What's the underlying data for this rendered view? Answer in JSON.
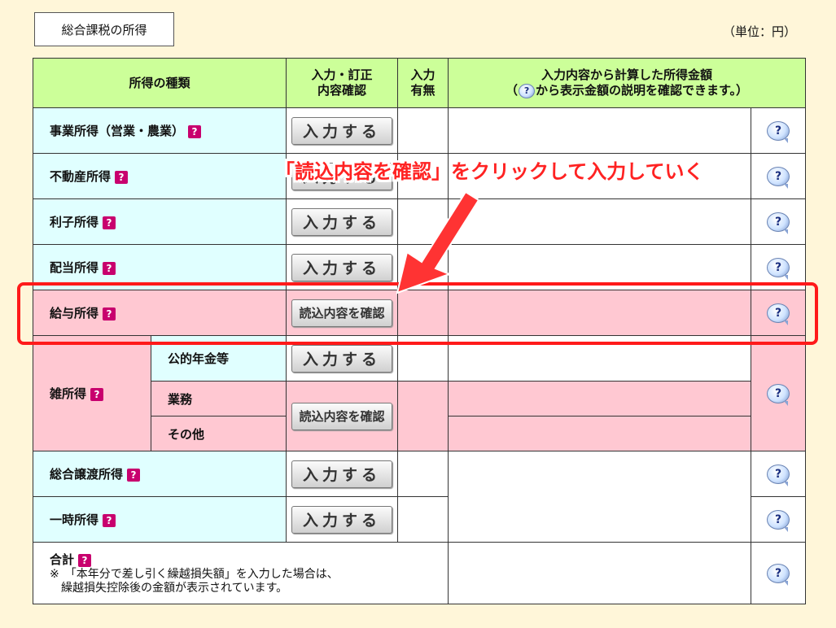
{
  "section_title": "総合課税の所得",
  "unit": "（単位：円）",
  "header": {
    "type": "所得の種類",
    "input_line1": "入力・訂正",
    "input_line2": "内容確認",
    "status_line1": "入力",
    "status_line2": "有無",
    "amount_line1": "入力内容から計算した所得金額",
    "amount_line2_pre": "（",
    "amount_line2_icon": "?",
    "amount_line2_post": "から表示金額の説明を確認できます。）"
  },
  "help_glyph": "?",
  "info_glyph": "?",
  "rows": [
    {
      "label": "事業所得（営業・農業）",
      "button": "入力する"
    },
    {
      "label": "不動産所得",
      "button": "入力する"
    },
    {
      "label": "利子所得",
      "button": "入力する"
    },
    {
      "label": "配当所得",
      "button": "入力する"
    },
    {
      "label": "給与所得",
      "button": "読込内容を確認"
    }
  ],
  "misc": {
    "label": "雑所得",
    "sub": [
      {
        "label": "公的年金等",
        "button": "入力する"
      },
      {
        "label": "業務"
      },
      {
        "label": "その他"
      }
    ],
    "shared_button": "読込内容を確認"
  },
  "rows2": [
    {
      "label": "総合譲渡所得",
      "button": "入力する"
    },
    {
      "label": "一時所得",
      "button": "入力する"
    }
  ],
  "total": {
    "label": "合計",
    "note_line1": "※　「本年分で差し引く繰越損失額」を入力した場合は、",
    "note_line2": "　繰越損失控除後の金額が表示されています。"
  },
  "annotation": "「読込内容を確認」をクリックして入力していく",
  "colors": {
    "header_bg": "#ccff99",
    "label_bg": "#e0ffff",
    "highlight_pink": "#ffc8d2",
    "annotation_red": "#ff2222",
    "background": "#fff6d9"
  }
}
